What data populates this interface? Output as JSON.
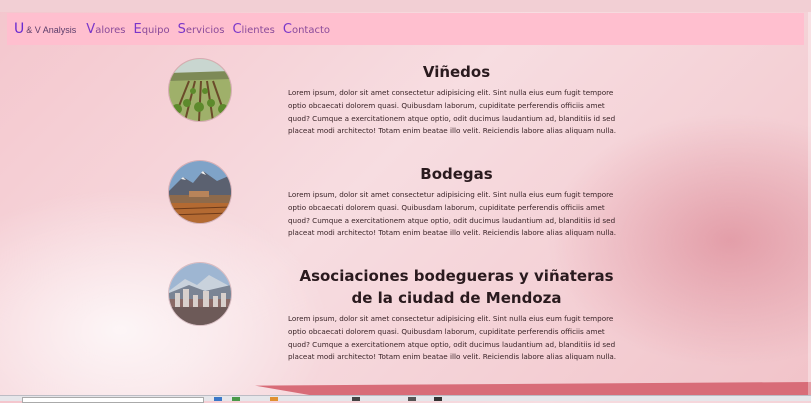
{
  "navbar": {
    "brand": {
      "initial": "U",
      "rest": "& V Analysis"
    },
    "items": [
      {
        "initial": "V",
        "rest": "alores"
      },
      {
        "initial": "E",
        "rest": "quipo"
      },
      {
        "initial": "S",
        "rest": "ervicios"
      },
      {
        "initial": "C",
        "rest": "lientes"
      },
      {
        "initial": "C",
        "rest": "ontacto"
      }
    ]
  },
  "sections": [
    {
      "title": "Viñedos",
      "image_icon": "vineyard-photo",
      "text": "Lorem ipsum, dolor sit amet consectetur adipisicing elit. Sint nulla eius eum fugit tempore optio obcaecati dolorem quasi. Quibusdam laborum, cupiditate perferendis officiis amet quod? Cumque a exercitationem atque optio, odit ducimus laudantium ad, blanditiis id sed placeat modi architecto! Totam enim beatae illo velit. Reiciendis labore alias aliquam nulla."
    },
    {
      "title": "Bodegas",
      "image_icon": "winery-mountains-photo",
      "text": "Lorem ipsum, dolor sit amet consectetur adipisicing elit. Sint nulla eius eum fugit tempore optio obcaecati dolorem quasi. Quibusdam laborum, cupiditate perferendis officiis amet quod? Cumque a exercitationem atque optio, odit ducimus laudantium ad, blanditiis id sed placeat modi architecto! Totam enim beatae illo velit. Reiciendis labore alias aliquam nulla."
    },
    {
      "title": "Asociaciones bodegueras y viñateras de la ciudad de Mendoza",
      "image_icon": "mendoza-city-photo",
      "text": "Lorem ipsum, dolor sit amet consectetur adipisicing elit. Sint nulla eius eum fugit tempore optio obcaecati dolorem quasi. Quibusdam laborum, cupiditate perferendis officiis amet quod? Cumque a exercitationem atque optio, odit ducimus laudantium ad, blanditiis id sed placeat modi architecto! Totam enim beatae illo velit. Reiciendis labore alias aliquam nulla."
    }
  ],
  "colors": {
    "navbar_bg": "#ffbfcf",
    "nav_initial": "#7a36c9",
    "accent_footer": "#d86c78",
    "page_bg": "#f4c6cd"
  }
}
